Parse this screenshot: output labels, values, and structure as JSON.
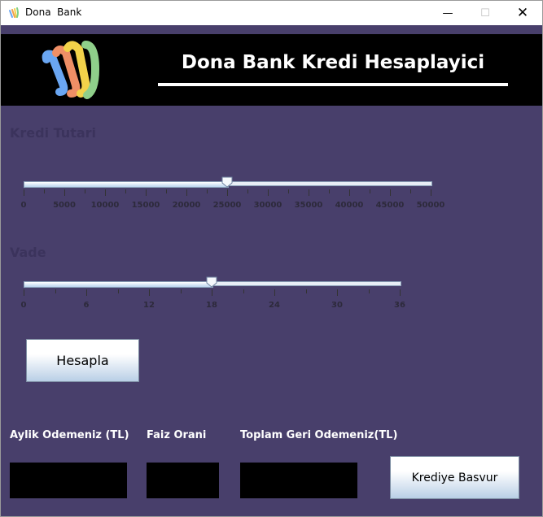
{
  "window": {
    "title": "Dona  Bank"
  },
  "header": {
    "title": "Dona Bank Kredi Hesaplayici"
  },
  "kredi": {
    "label": "Kredi Tutari",
    "min": 0,
    "max": 50000,
    "value": 25000,
    "tick_labels": [
      "0",
      "5000",
      "10000",
      "15000",
      "20000",
      "25000",
      "30000",
      "35000",
      "40000",
      "45000",
      "50000"
    ]
  },
  "vade": {
    "label": "Vade",
    "min": 0,
    "max": 36,
    "value": 18,
    "tick_labels": [
      "0",
      "6",
      "12",
      "18",
      "24",
      "30",
      "36"
    ]
  },
  "buttons": {
    "hesapla": "Hesapla",
    "basvur": "Krediye Basvur"
  },
  "outputs": {
    "aylik_label": "Aylik Odemeniz (TL)",
    "faiz_label": "Faiz Orani",
    "toplam_label": "Toplam Geri Odemeniz(TL)",
    "aylik_value": "",
    "faiz_value": "",
    "toplam_value": ""
  }
}
